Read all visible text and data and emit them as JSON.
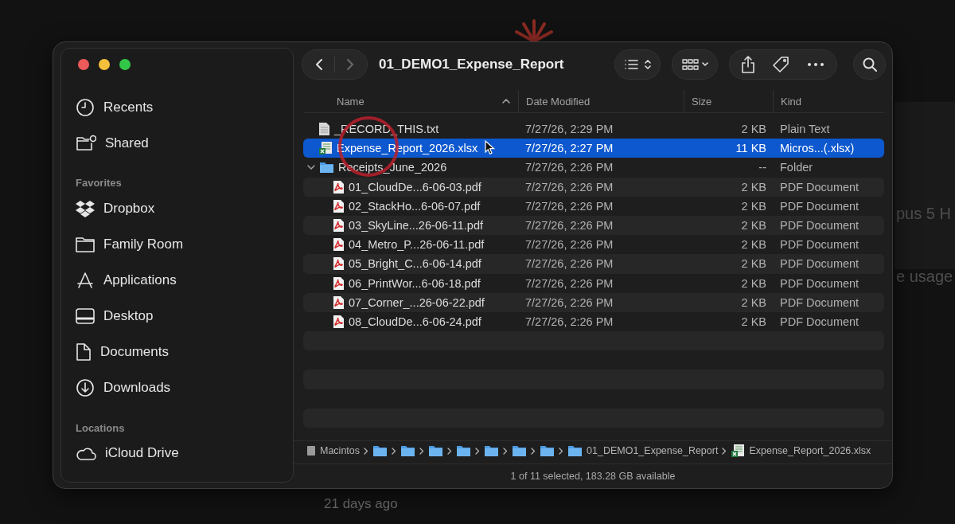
{
  "background": {
    "fragments": [
      "pus 5 H",
      "e usage"
    ],
    "footnote": "21 days ago"
  },
  "window": {
    "title": "01_DEMO1_Expense_Report",
    "back_disabled": false,
    "forward_disabled": true
  },
  "sidebar": {
    "items": [
      {
        "label": "Recents",
        "selected": false
      },
      {
        "label": "Shared",
        "selected": false
      }
    ],
    "sections": [
      {
        "title": "Favorites",
        "items": [
          {
            "label": "Dropbox",
            "selected": false
          },
          {
            "label": "Family Room",
            "selected": false
          },
          {
            "label": "Applications",
            "selected": false
          },
          {
            "label": "Desktop",
            "selected": false
          },
          {
            "label": "Documents",
            "selected": false
          },
          {
            "label": "Downloads",
            "selected": false
          }
        ]
      },
      {
        "title": "Locations",
        "items": [
          {
            "label": "iCloud Drive",
            "selected": false
          }
        ]
      }
    ]
  },
  "table": {
    "columns": [
      {
        "label": "Name",
        "sorted": true
      },
      {
        "label": "Date Modified",
        "sorted": false
      },
      {
        "label": "Size",
        "sorted": false
      },
      {
        "label": "Kind",
        "sorted": false
      }
    ],
    "rows": [
      {
        "kind": "text",
        "name": "_RECORD_THIS.txt",
        "date": "7/27/26, 2:29 PM",
        "size": "2 KB",
        "type": "Plain Text",
        "selected": false
      },
      {
        "kind": "spreadsheet",
        "name": "Expense_Report_2026.xlsx",
        "date": "7/27/26, 2:27 PM",
        "size": "11 KB",
        "type": "Micros...(.xlsx)",
        "selected": true
      },
      {
        "kind": "folder",
        "name": "Receipts_June_2026",
        "date": "7/27/26, 2:26 PM",
        "size": "--",
        "type": "Folder",
        "selected": false,
        "expanded": true,
        "children": [
          {
            "kind": "pdf",
            "name": "01_CloudDe...6-06-03.pdf",
            "date": "7/27/26, 2:26 PM",
            "size": "2 KB",
            "type": "PDF Document",
            "selected": false
          },
          {
            "kind": "pdf",
            "name": "02_StackHo...6-06-07.pdf",
            "date": "7/27/26, 2:26 PM",
            "size": "2 KB",
            "type": "PDF Document",
            "selected": false
          },
          {
            "kind": "pdf",
            "name": "03_SkyLine...26-06-11.pdf",
            "date": "7/27/26, 2:26 PM",
            "size": "2 KB",
            "type": "PDF Document",
            "selected": false
          },
          {
            "kind": "pdf",
            "name": "04_Metro_P...26-06-11.pdf",
            "date": "7/27/26, 2:26 PM",
            "size": "2 KB",
            "type": "PDF Document",
            "selected": false
          },
          {
            "kind": "pdf",
            "name": "05_Bright_C...6-06-14.pdf",
            "date": "7/27/26, 2:26 PM",
            "size": "2 KB",
            "type": "PDF Document",
            "selected": false
          },
          {
            "kind": "pdf",
            "name": "06_PrintWor...6-06-18.pdf",
            "date": "7/27/26, 2:26 PM",
            "size": "2 KB",
            "type": "PDF Document",
            "selected": false
          },
          {
            "kind": "pdf",
            "name": "07_Corner_...26-06-22.pdf",
            "date": "7/27/26, 2:26 PM",
            "size": "2 KB",
            "type": "PDF Document",
            "selected": false
          },
          {
            "kind": "pdf",
            "name": "08_CloudDe...6-06-24.pdf",
            "date": "7/27/26, 2:26 PM",
            "size": "2 KB",
            "type": "PDF Document",
            "selected": false
          }
        ]
      }
    ]
  },
  "path_bar": [
    {
      "kind": "disk",
      "label": "Macintos"
    },
    {
      "kind": "folder"
    },
    {
      "kind": "folder"
    },
    {
      "kind": "folder"
    },
    {
      "kind": "folder"
    },
    {
      "kind": "folder"
    },
    {
      "kind": "folder"
    },
    {
      "kind": "folder"
    },
    {
      "kind": "folder",
      "label": "01_DEMO1_Expense_Report"
    },
    {
      "kind": "spreadsheet",
      "label": "Expense_Report_2026.xlsx"
    }
  ],
  "status_bar": "1 of 11 selected, 183.28 GB available"
}
